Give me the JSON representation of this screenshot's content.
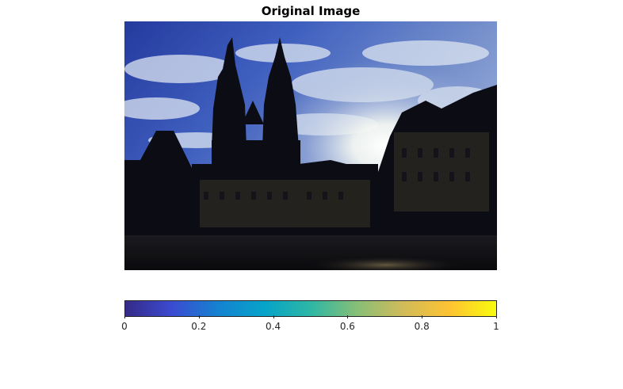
{
  "figure": {
    "title": "Original Image"
  },
  "colorbar": {
    "colormap": "parula",
    "range": [
      0,
      1
    ],
    "stops": [
      "#352a87",
      "#3b4bd1",
      "#1582d1",
      "#06a4ca",
      "#2eb7a4",
      "#87bf77",
      "#d1bb59",
      "#fec332",
      "#f9fb0e"
    ],
    "tick_values": [
      0,
      0.2,
      0.4,
      0.6,
      0.8,
      1
    ],
    "tick_labels": [
      "0",
      "0.2",
      "0.4",
      "0.6",
      "0.8",
      "1"
    ]
  },
  "photo": {
    "description_icon": "photo-image",
    "sky_colors": [
      "#2a3d9a",
      "#5b79c8",
      "#d6e0ee",
      "#ffffff"
    ],
    "silhouette_color": "#0b0c14"
  }
}
